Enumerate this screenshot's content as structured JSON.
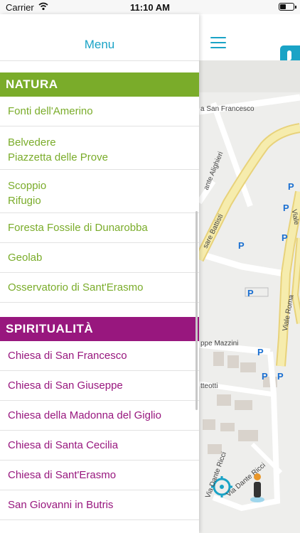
{
  "status_bar": {
    "carrier": "Carrier",
    "time": "11:10 AM"
  },
  "drawer": {
    "title": "Menu",
    "sections": [
      {
        "title": "NATURA",
        "color": "#7aac2a",
        "items": [
          {
            "lines": [
              "Fonti dell'Amerino"
            ]
          },
          {
            "lines": [
              "Belvedere",
              "Piazzetta delle Prove"
            ]
          },
          {
            "lines": [
              "Scoppio",
              "Rifugio"
            ]
          },
          {
            "lines": [
              "Foresta Fossile di Dunarobba"
            ]
          },
          {
            "lines": [
              "Geolab"
            ]
          },
          {
            "lines": [
              "Osservatorio di Sant'Erasmo"
            ]
          }
        ]
      },
      {
        "title": "SPIRITUALITÀ",
        "color": "#98177e",
        "items": [
          {
            "lines": [
              "Chiesa di San Francesco"
            ]
          },
          {
            "lines": [
              "Chiesa di San Giuseppe"
            ]
          },
          {
            "lines": [
              "Chiesa della Madonna del Giglio"
            ]
          },
          {
            "lines": [
              "Chiesa di Santa Cecilia"
            ]
          },
          {
            "lines": [
              "Chiesa di Sant'Erasmo"
            ]
          },
          {
            "lines": [
              "San Giovanni in Butris"
            ]
          }
        ]
      }
    ]
  },
  "map": {
    "accent": "#1aa3c6",
    "labels": {
      "san_francesco": "a San Francesco",
      "alighieri": "ante Alighieri",
      "battisti": "sare Battisti",
      "viale_roma": "Viale Roma",
      "viale_right": "Viale",
      "mazzini": "ppe Mazzini",
      "matteotti": "tteotti",
      "dante_ricci": "Via Dante Ricci",
      "via_dante_ricci_2": "Via Dante Ricci",
      "parking": "P"
    }
  }
}
